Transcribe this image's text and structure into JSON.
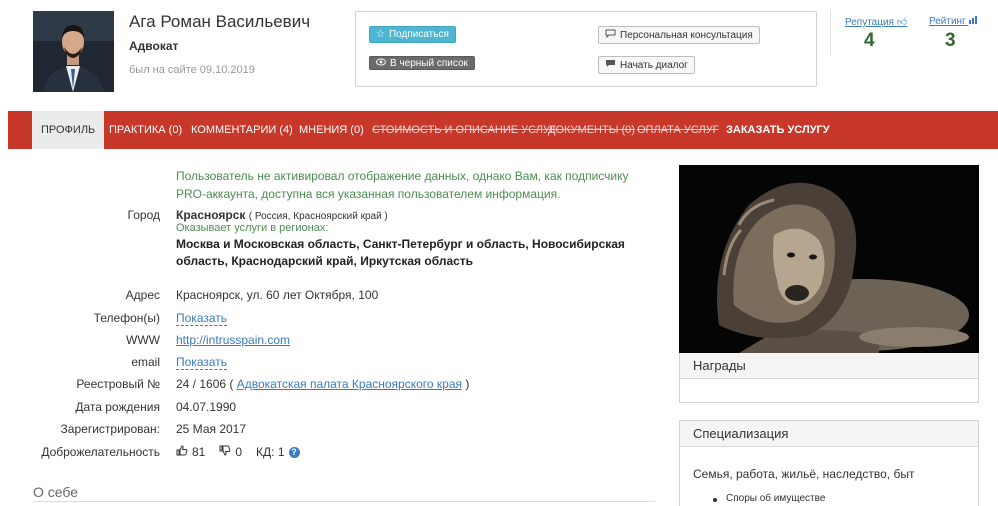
{
  "profile": {
    "name": "Ага Роман Васильевич",
    "role": "Адвокат",
    "last_seen": "был на сайте 09.10.2019"
  },
  "actions": {
    "subscribe": "Подписаться",
    "blacklist": "В черный список",
    "consultation": "Персональная консультация",
    "dialog": "Начать диалог"
  },
  "stats": {
    "reputation_label": "Репутация",
    "reputation_value": "4",
    "rating_label": "Рейтинг",
    "rating_value": "3"
  },
  "nav": [
    {
      "label": "ПРОФИЛЬ"
    },
    {
      "label": "ПРАКТИКА (0)"
    },
    {
      "label": "КОММЕНТАРИИ (4)"
    },
    {
      "label": "МНЕНИЯ (0)"
    },
    {
      "label": "СТОИМОСТЬ И ОПИСАНИЕ УСЛУГ"
    },
    {
      "label": "ДОКУМЕНТЫ (0)"
    },
    {
      "label": "ОПЛАТА УСЛУГ"
    },
    {
      "label": "ЗАКАЗАТЬ УСЛУГУ"
    }
  ],
  "notice": "Пользователь не активировал отображение данных, однако Вам, как подписчику PRO-аккаунта, доступна вся указанная пользователем информация.",
  "info": {
    "city_label": "Город",
    "city_value": "Красноярск",
    "city_region": "( Россия, Красноярский край )",
    "regions_label": "Оказывает услуги в регионах:",
    "regions_value": "Москва и Московская область, Санкт-Петербург и область, Новосибирская область, Краснодарский край, Иркутская область",
    "address_label": "Адрес",
    "address_value": "Красноярск, ул. 60 лет Октября, 100",
    "phone_label": "Телефон(ы)",
    "phone_value": "Показать",
    "www_label": "WWW",
    "www_value": "http://intrusspain.com",
    "email_label": "email",
    "email_value": "Показать",
    "registry_label": "Реестровый №",
    "registry_number": "24 / 1606",
    "registry_open": "(",
    "registry_link": "Адвокатская палата Красноярского края",
    "registry_close": ")",
    "birth_label": "Дата рождения",
    "birth_value": "04.07.1990",
    "registered_label": "Зарегистрирован:",
    "registered_value": "25 Мая 2017",
    "goodwill_label": "Доброжелательность",
    "likes": "81",
    "dislikes": "0",
    "kd": "КД: 1"
  },
  "about_title": "О себе",
  "sidebar": {
    "awards_title": "Награды",
    "spec_title": "Специализация",
    "spec_area": "Семья, работа, жильё, наследство, быт",
    "spec_items": [
      "Споры об имуществе"
    ]
  },
  "colors": {
    "nav_bg": "#c7372a",
    "subscribe_bg": "#4db6d0",
    "notice_text": "#4c8c52",
    "stat_value": "#2e6a2e",
    "link": "#3a7bbf"
  }
}
